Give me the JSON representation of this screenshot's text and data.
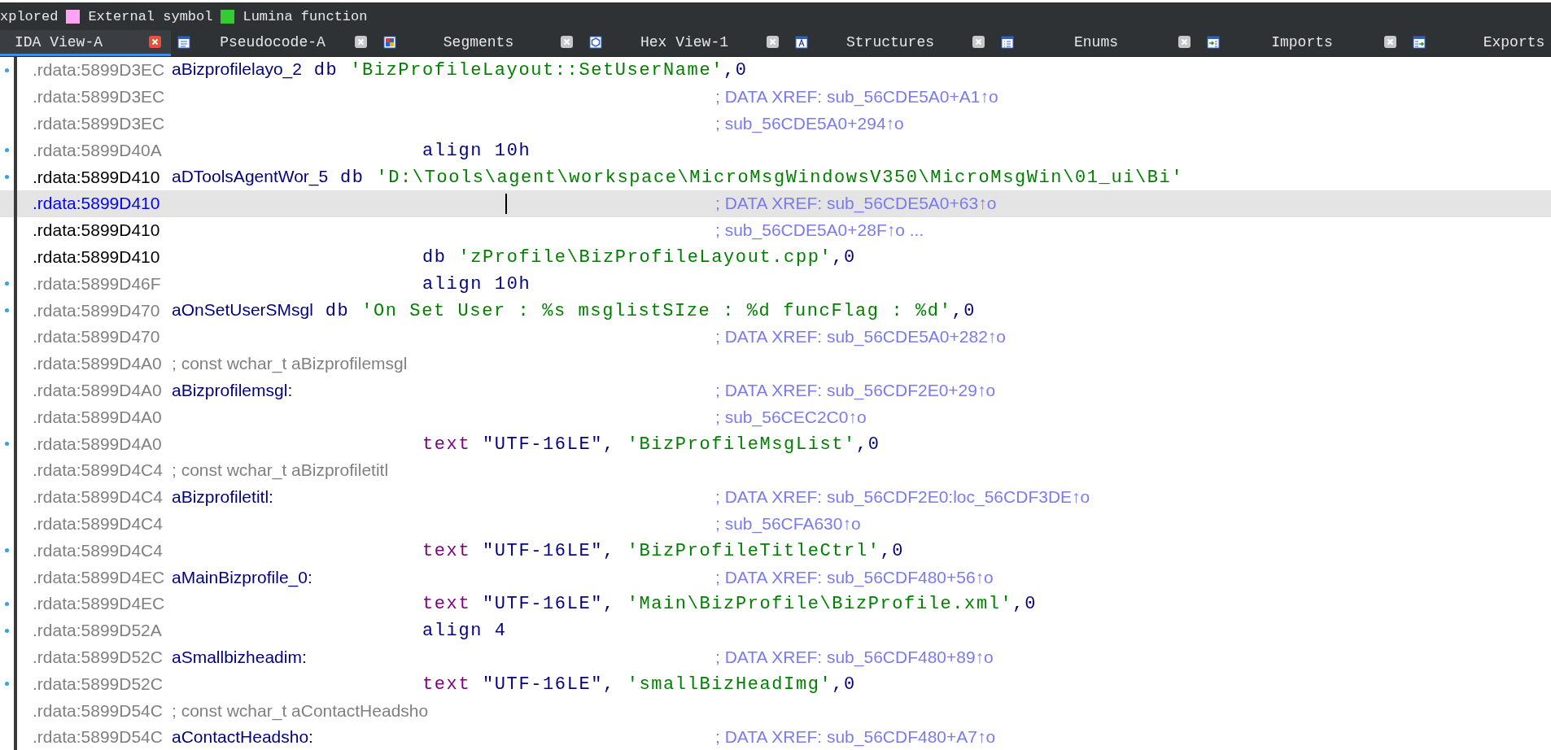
{
  "legend": [
    {
      "label": "xplored"
    },
    {
      "label": "External symbol",
      "color": "#ffa3f5"
    },
    {
      "label": "Lumina function",
      "color": "#33cc33"
    }
  ],
  "tabs": [
    {
      "label": "IDA View-A",
      "selected": true,
      "icon": false,
      "closable": true
    },
    {
      "label": "Pseudocode-A",
      "selected": false,
      "icon": true,
      "closable": true
    },
    {
      "label": "Segments",
      "selected": false,
      "icon": true,
      "closable": true
    },
    {
      "label": "Hex View-1",
      "selected": false,
      "icon": true,
      "closable": true
    },
    {
      "label": "Structures",
      "selected": false,
      "icon": true,
      "closable": true
    },
    {
      "label": "Enums",
      "selected": false,
      "icon": true,
      "closable": true
    },
    {
      "label": "Imports",
      "selected": false,
      "icon": true,
      "closable": true
    },
    {
      "label": "Exports",
      "selected": false,
      "icon": true,
      "closable": false
    }
  ],
  "lines": [
    {
      "address": ".rdata:5899D3EC",
      "marked": true,
      "current": false,
      "selected": false,
      "kind": "label",
      "code": [
        {
          "kind": "name",
          "text": "aBizprofilelayo_2"
        },
        {
          "kind": "kw",
          "text": " db "
        },
        {
          "kind": "str",
          "text": "'BizProfileLayout::SetUserName'"
        },
        {
          "kind": "punct",
          "text": ",0"
        }
      ]
    },
    {
      "address": ".rdata:5899D3EC",
      "marked": false,
      "current": false,
      "selected": false,
      "kind": "label",
      "comment": "; DATA XREF: sub_56CDE5A0+A1↑o"
    },
    {
      "address": ".rdata:5899D3EC",
      "marked": false,
      "current": false,
      "selected": false,
      "kind": "label",
      "comment": "; sub_56CDE5A0+294↑o"
    },
    {
      "address": ".rdata:5899D40A",
      "marked": true,
      "current": false,
      "selected": false,
      "kind": "instr",
      "code": [
        {
          "kind": "kw",
          "text": "align "
        },
        {
          "kind": "punct",
          "text": "10h"
        }
      ]
    },
    {
      "address": ".rdata:5899D410",
      "marked": true,
      "current": true,
      "selected": false,
      "kind": "label",
      "code": [
        {
          "kind": "name",
          "text": "aDToolsAgentWor_5"
        },
        {
          "kind": "kw",
          "text": " db "
        },
        {
          "kind": "str",
          "text": "'D:\\Tools\\agent\\workspace\\MicroMsgWindowsV350\\MicroMsgWin\\01_ui\\Bi'"
        }
      ]
    },
    {
      "address": ".rdata:5899D410",
      "marked": false,
      "current": true,
      "selected": true,
      "kind": "label",
      "comment": "; DATA XREF: sub_56CDE5A0+63↑o"
    },
    {
      "address": ".rdata:5899D410",
      "marked": false,
      "current": true,
      "selected": false,
      "kind": "label",
      "comment": "; sub_56CDE5A0+28F↑o ..."
    },
    {
      "address": ".rdata:5899D410",
      "marked": false,
      "current": true,
      "selected": false,
      "kind": "instr",
      "code": [
        {
          "kind": "kw",
          "text": "db "
        },
        {
          "kind": "str",
          "text": "'zProfile\\BizProfileLayout.cpp'"
        },
        {
          "kind": "punct",
          "text": ",0"
        }
      ]
    },
    {
      "address": ".rdata:5899D46F",
      "marked": true,
      "current": false,
      "selected": false,
      "kind": "instr",
      "code": [
        {
          "kind": "kw",
          "text": "align "
        },
        {
          "kind": "punct",
          "text": "10h"
        }
      ]
    },
    {
      "address": ".rdata:5899D470",
      "marked": true,
      "current": false,
      "selected": false,
      "kind": "label",
      "code": [
        {
          "kind": "name",
          "text": "aOnSetUserSMsgl"
        },
        {
          "kind": "kw",
          "text": " db "
        },
        {
          "kind": "str",
          "text": "'On Set User : %s msglistSIze : %d funcFlag : %d'"
        },
        {
          "kind": "punct",
          "text": ",0"
        }
      ]
    },
    {
      "address": ".rdata:5899D470",
      "marked": false,
      "current": false,
      "selected": false,
      "kind": "label",
      "comment": "; DATA XREF: sub_56CDE5A0+282↑o"
    },
    {
      "address": ".rdata:5899D4A0",
      "marked": false,
      "current": false,
      "selected": false,
      "kind": "label",
      "code": [
        {
          "kind": "note",
          "text": "; const wchar_t aBizprofilemsgl"
        }
      ]
    },
    {
      "address": ".rdata:5899D4A0",
      "marked": false,
      "current": false,
      "selected": false,
      "kind": "label",
      "code": [
        {
          "kind": "name",
          "text": "aBizprofilemsgl:"
        }
      ],
      "comment": "; DATA XREF: sub_56CDF2E0+29↑o"
    },
    {
      "address": ".rdata:5899D4A0",
      "marked": false,
      "current": false,
      "selected": false,
      "kind": "label",
      "comment": "; sub_56CEC2C0↑o"
    },
    {
      "address": ".rdata:5899D4A0",
      "marked": true,
      "current": false,
      "selected": false,
      "kind": "instr",
      "code": [
        {
          "kind": "text",
          "text": "text "
        },
        {
          "kind": "punct",
          "text": "\"UTF-16LE\", "
        },
        {
          "kind": "str",
          "text": "'BizProfileMsgList'"
        },
        {
          "kind": "punct",
          "text": ",0"
        }
      ]
    },
    {
      "address": ".rdata:5899D4C4",
      "marked": false,
      "current": false,
      "selected": false,
      "kind": "label",
      "code": [
        {
          "kind": "note",
          "text": "; const wchar_t aBizprofiletitl"
        }
      ]
    },
    {
      "address": ".rdata:5899D4C4",
      "marked": false,
      "current": false,
      "selected": false,
      "kind": "label",
      "code": [
        {
          "kind": "name",
          "text": "aBizprofiletitl:"
        }
      ],
      "comment": "; DATA XREF: sub_56CDF2E0:loc_56CDF3DE↑o"
    },
    {
      "address": ".rdata:5899D4C4",
      "marked": false,
      "current": false,
      "selected": false,
      "kind": "label",
      "comment": "; sub_56CFA630↑o"
    },
    {
      "address": ".rdata:5899D4C4",
      "marked": true,
      "current": false,
      "selected": false,
      "kind": "instr",
      "code": [
        {
          "kind": "text",
          "text": "text "
        },
        {
          "kind": "punct",
          "text": "\"UTF-16LE\", "
        },
        {
          "kind": "str",
          "text": "'BizProfileTitleCtrl'"
        },
        {
          "kind": "punct",
          "text": ",0"
        }
      ]
    },
    {
      "address": ".rdata:5899D4EC",
      "marked": false,
      "current": false,
      "selected": false,
      "kind": "label",
      "code": [
        {
          "kind": "name",
          "text": "aMainBizprofile_0:"
        }
      ],
      "comment": "; DATA XREF: sub_56CDF480+56↑o"
    },
    {
      "address": ".rdata:5899D4EC",
      "marked": true,
      "current": false,
      "selected": false,
      "kind": "instr",
      "code": [
        {
          "kind": "text",
          "text": "text "
        },
        {
          "kind": "punct",
          "text": "\"UTF-16LE\", "
        },
        {
          "kind": "str",
          "text": "'Main\\BizProfile\\BizProfile.xml'"
        },
        {
          "kind": "punct",
          "text": ",0"
        }
      ]
    },
    {
      "address": ".rdata:5899D52A",
      "marked": true,
      "current": false,
      "selected": false,
      "kind": "instr",
      "code": [
        {
          "kind": "kw",
          "text": "align "
        },
        {
          "kind": "punct",
          "text": "4"
        }
      ]
    },
    {
      "address": ".rdata:5899D52C",
      "marked": false,
      "current": false,
      "selected": false,
      "kind": "label",
      "code": [
        {
          "kind": "name",
          "text": "aSmallbizheadim:"
        }
      ],
      "comment": "; DATA XREF: sub_56CDF480+89↑o"
    },
    {
      "address": ".rdata:5899D52C",
      "marked": true,
      "current": false,
      "selected": false,
      "kind": "instr",
      "code": [
        {
          "kind": "text",
          "text": "text "
        },
        {
          "kind": "punct",
          "text": "\"UTF-16LE\", "
        },
        {
          "kind": "str",
          "text": "'smallBizHeadImg'"
        },
        {
          "kind": "punct",
          "text": ",0"
        }
      ]
    },
    {
      "address": ".rdata:5899D54C",
      "marked": false,
      "current": false,
      "selected": false,
      "kind": "label",
      "code": [
        {
          "kind": "note",
          "text": "; const wchar_t aContactHeadsho"
        }
      ]
    },
    {
      "address": ".rdata:5899D54C",
      "marked": false,
      "current": false,
      "selected": false,
      "kind": "label",
      "code": [
        {
          "kind": "name",
          "text": "aContactHeadsho:"
        }
      ],
      "comment": "; DATA XREF: sub_56CDF480+A7↑o"
    }
  ]
}
